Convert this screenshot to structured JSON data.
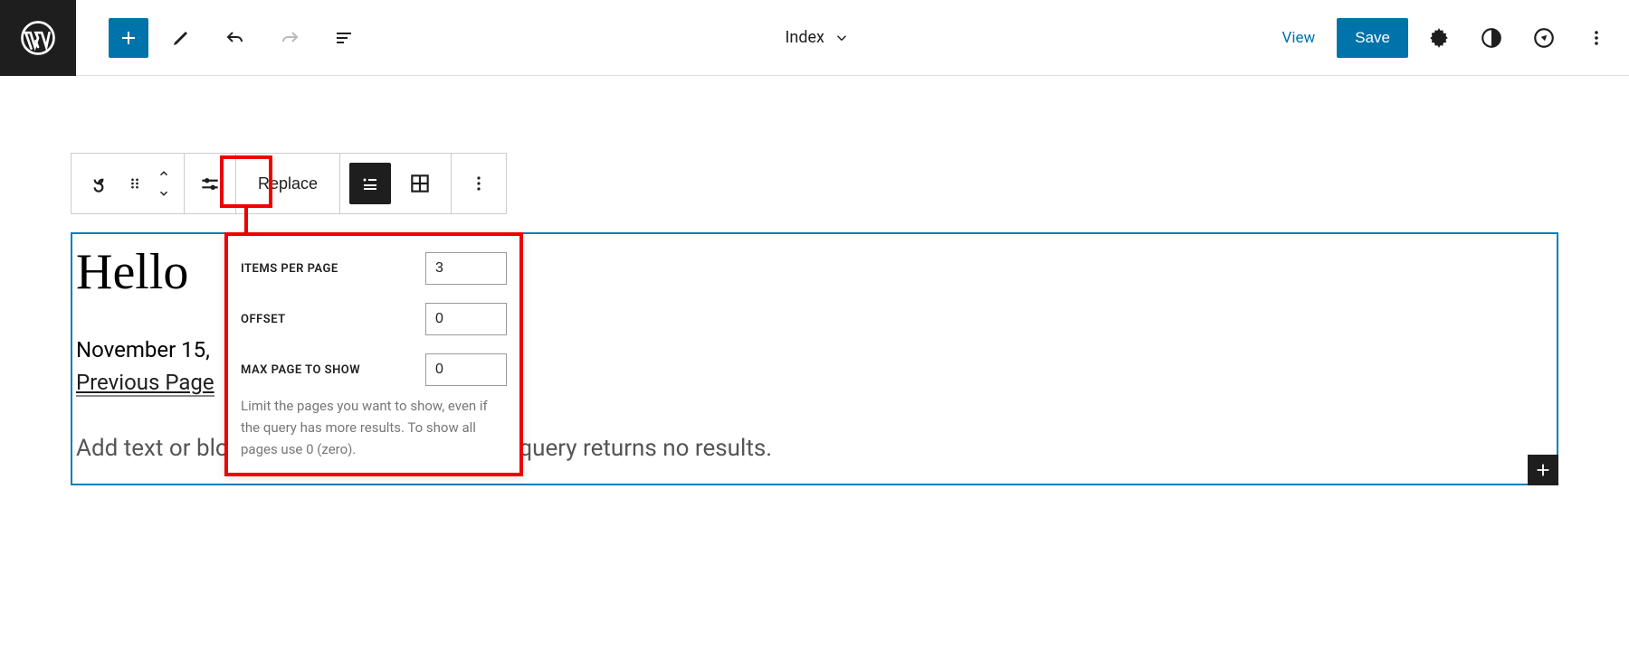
{
  "header": {
    "template_name": "Index",
    "view_link": "View",
    "save_label": "Save"
  },
  "block_toolbar": {
    "replace_label": "Replace"
  },
  "settings_popover": {
    "items_per_page": {
      "label": "Items Per Page",
      "value": "3"
    },
    "offset": {
      "label": "Offset",
      "value": "0"
    },
    "max_page": {
      "label": "Max page to show",
      "value": "0"
    },
    "help_text": "Limit the pages you want to show, even if the query has more results. To show all pages use 0 (zero)."
  },
  "canvas": {
    "post_title": "Hello",
    "post_date": "November 15,",
    "prev_page": "Previous Page",
    "no_results_placeholder": "Add text or blocks that will display when a query returns no results."
  }
}
